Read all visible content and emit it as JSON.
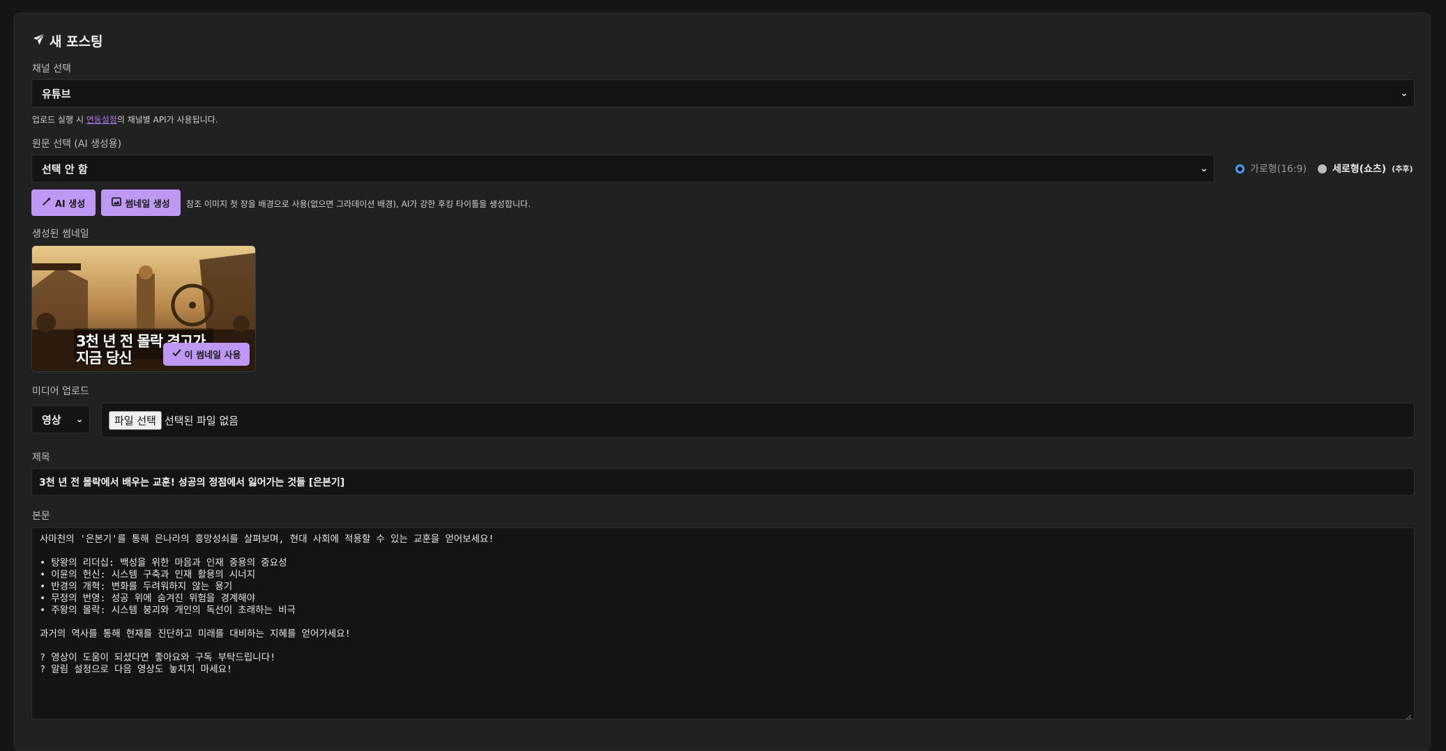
{
  "header": {
    "title": "새 포스팅",
    "icon": "paper-plane-icon"
  },
  "channel": {
    "label": "채널 선택",
    "selected": "유튜브",
    "hint_before": "업로드 실행 시 ",
    "hint_link": "연동설정",
    "hint_after": "의 채널별 API가 사용됩니다."
  },
  "source": {
    "label": "원문 선택 (AI 생성용)",
    "selected": "선택 안 함",
    "orientation_options": [
      {
        "label": "가로형(16:9)",
        "checked": true
      },
      {
        "label": "세로형(쇼츠)",
        "checked": false,
        "note": "(추후)"
      }
    ]
  },
  "actions": {
    "ai_button": "AI 생성",
    "thumbnail_button": "썸네일 생성",
    "hint": "참조 이미지 첫 장을 배경으로 사용(없으면 그라데이션 배경), AI가 강한 후킹 타이틀을 생성합니다."
  },
  "thumbnail": {
    "label": "생성된 썸네일",
    "overlay_line1": "3천 년 전 몰락 경고가",
    "overlay_line2": "지금 당신",
    "use_button": "이 썸네일 사용"
  },
  "media": {
    "label": "미디어 업로드",
    "type_selected": "영상",
    "file_button": "파일 선택",
    "file_status": "선택된 파일 없음"
  },
  "post_title": {
    "label": "제목",
    "value": "3천 년 전 몰락에서 배우는 교훈! 성공의 정점에서 잃어가는 것들 [은본기]"
  },
  "body": {
    "label": "본문",
    "value": "사마천의 '은본기'를 통해 은나라의 흥망성쇠를 살펴보며, 현대 사회에 적용할 수 있는 교훈을 얻어보세요!\n\n• 탕왕의 리더십: 백성을 위한 마음과 인재 중용의 중요성\n• 이윤의 헌신: 시스템 구축과 인재 활용의 시너지\n• 반경의 개혁: 변화를 두려워하지 않는 용기\n• 무정의 번영: 성공 위에 숨겨진 위험을 경계해야\n• 주왕의 몰락: 시스템 붕괴와 개인의 독선이 초래하는 비극\n\n과거의 역사를 통해 현재를 진단하고 미래를 대비하는 지혜를 얻어가세요!\n\n? 영상이 도움이 되셨다면 좋아요와 구독 부탁드립니다!\n? 알림 설정으로 다음 영상도 놓치지 마세요!"
  },
  "colors": {
    "accent": "#bf98f4",
    "background": "#151515",
    "panel": "#212121",
    "field": "#141414"
  }
}
